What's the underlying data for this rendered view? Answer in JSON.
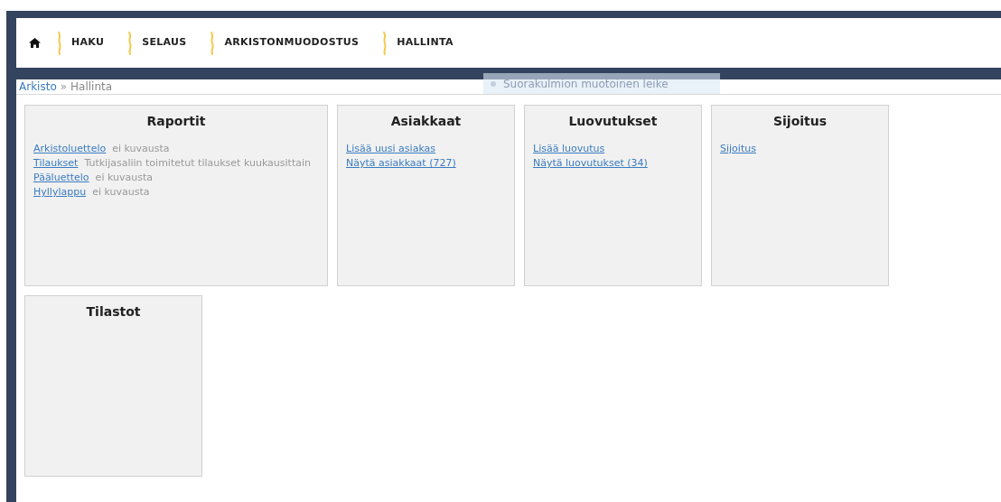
{
  "nav": {
    "items": [
      {
        "label": "HAKU"
      },
      {
        "label": "SELAUS"
      },
      {
        "label": "ARKISTONMUODOSTUS"
      },
      {
        "label": "HALLINTA"
      }
    ]
  },
  "breadcrumb": {
    "link": "Arkisto",
    "separator": "»",
    "current": "Hallinta"
  },
  "tooltip": {
    "text": "Suorakulmion muotoinen leike"
  },
  "cards": [
    {
      "title": "Raportit",
      "wide": true,
      "links": [
        {
          "label": "Arkistoluettelo",
          "description": "ei kuvausta"
        },
        {
          "label": "Tilaukset",
          "description": "Tutkijasaliin toimitetut tilaukset kuukausittain"
        },
        {
          "label": "Pääluettelo",
          "description": "ei kuvausta"
        },
        {
          "label": "Hyllylappu",
          "description": "ei kuvausta"
        }
      ]
    },
    {
      "title": "Asiakkaat",
      "wide": false,
      "links": [
        {
          "label": "Lisää uusi asiakas"
        },
        {
          "label": "Näytä asiakkaat (727)"
        }
      ]
    },
    {
      "title": "Luovutukset",
      "wide": false,
      "links": [
        {
          "label": "Lisää luovutus"
        },
        {
          "label": "Näytä luovutukset (34)"
        }
      ]
    },
    {
      "title": "Sijoitus",
      "wide": false,
      "links": [
        {
          "label": "Sijoitus"
        }
      ]
    },
    {
      "title": "Tilastot",
      "wide": false
    }
  ]
}
